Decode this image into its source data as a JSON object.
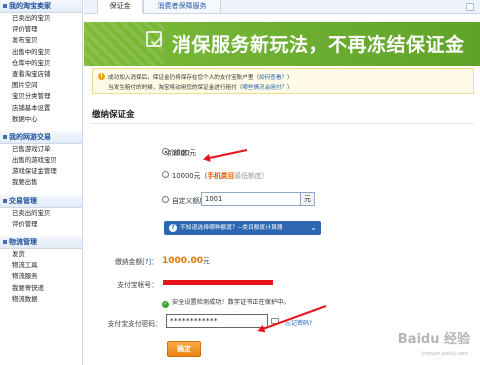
{
  "sidebar": {
    "groups": [
      {
        "title": "我的淘宝卖家",
        "items": [
          "已卖出的宝贝",
          "评价管理",
          "发布宝贝",
          "出售中的宝贝",
          "仓库中的宝贝",
          "查看淘宝店铺",
          "图片空间",
          "宝贝分类管理",
          "店铺基本设置",
          "数据中心"
        ]
      },
      {
        "title": "我的网游交易",
        "items": [
          "已售游戏订单",
          "出售的游戏宝贝",
          "游戏保证金管理",
          "我要出售"
        ]
      },
      {
        "title": "交易管理",
        "items": [
          "已卖出的宝贝",
          "评价管理"
        ]
      },
      {
        "title": "物流管理",
        "items": [
          "发货",
          "物流工具",
          "物流服务",
          "我要寄快递",
          "物流数据"
        ]
      }
    ]
  },
  "tabs": [
    "保证金",
    "消费者保障服务"
  ],
  "banner": {
    "text": "消保服务新玩法，不再冻结保证金"
  },
  "notice": {
    "line1_text": "成功加入消保后，保证金仍将保存在您个人的支付宝账户里（",
    "line1_link": "如何查看？",
    "line1_end": "）",
    "line2_text": "当发生赔付的时候，淘宝将动用您的保证金进行赔付（",
    "line2_link": "哪些情况会赔付？",
    "line2_end": "）"
  },
  "section_title": "缴纳保证金",
  "form": {
    "amount_label": "新额度：",
    "option1": "1000元",
    "option2_prefix": "10000元（",
    "option2_highlight": "手机类目",
    "option2_suffix": "最低额度）",
    "option3": "自定义额度",
    "custom_value": "1001",
    "custom_unit": "元",
    "help_text": "不知道选择哪种额度？--类目额度计算器",
    "help_chevron": "⌄",
    "paid_label": "缴纳金额",
    "paid_help": "[?]",
    "paid_colon": "：",
    "paid_value": "1000.00",
    "paid_unit": "元",
    "alipay_account_label": "支付宝帐号：",
    "secure_text": "安全设置检测成功！数字证书正在保护中。",
    "pwd_label": "支付宝支付密码：",
    "pwd_value": "************",
    "forgot_link": "忘记密码?",
    "submit": "确定"
  },
  "watermark": {
    "main": "Baidu 经验",
    "sub": "jingyan.baidu.com"
  },
  "colors": {
    "banner_green": "#6fb232",
    "link_blue": "#1d5fb0",
    "arrow_red": "#e8141b",
    "orange_button": "#f09a2f"
  }
}
